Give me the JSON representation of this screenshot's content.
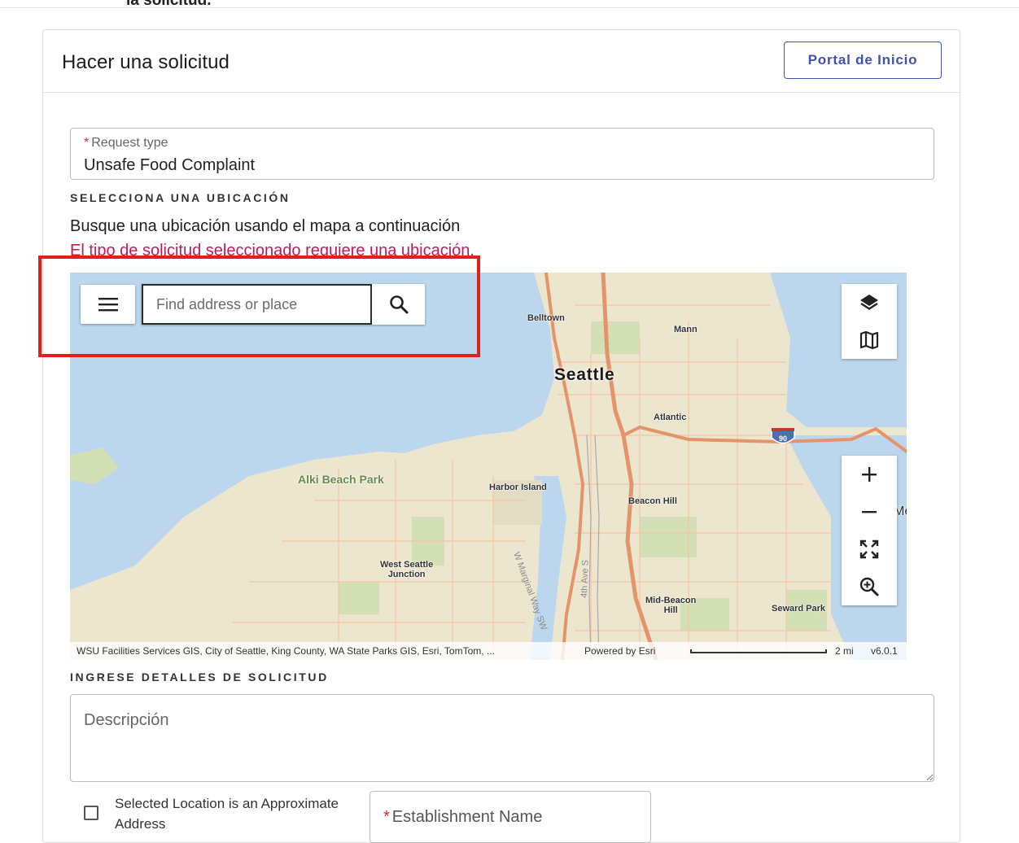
{
  "top_fragment": "la solicitud.",
  "card": {
    "title": "Hacer una solicitud",
    "portal_button": "Portal de Inicio"
  },
  "request_type": {
    "required_mark": "*",
    "label": "Request type",
    "value": "Unsafe Food Complaint"
  },
  "location": {
    "heading": "SELECCIONA UNA UBICACIÓN",
    "hint": "Busque una ubicación usando el mapa a continuación",
    "error": "El tipo de solicitud seleccionado requiere una ubicación."
  },
  "map": {
    "search_placeholder": "Find address or place",
    "labels": {
      "belltown": "Belltown",
      "mann": "Mann",
      "seattle": "Seattle",
      "atlantic": "Atlantic",
      "alki": "Alki Beach Park",
      "harbor": "Harbor Island",
      "beacon_hill": "Beacon Hill",
      "west_seattle_1": "West Seattle",
      "west_seattle_2": "Junction",
      "mid_beacon_1": "Mid-Beacon",
      "mid_beacon_2": "Hill",
      "seward": "Seward Park",
      "w_marginal": "W Marginal Way SW",
      "fourth_ave": "4th Ave S",
      "interstate": "90",
      "edge_fragment": "Me"
    },
    "attribution": "WSU Facilities Services GIS, City of Seattle, King County, WA State Parks GIS, Esri, TomTom, ...",
    "powered_by": "Powered by Esri",
    "scale": "2 mi",
    "version": "v6.0.1"
  },
  "details": {
    "heading": "INGRESE DETALLES DE SOLICITUD",
    "description_placeholder": "Descripción",
    "approx_checkbox_label": "Selected Location is an Approximate Address",
    "establishment_required": "*",
    "establishment_label": "Establishment Name"
  },
  "colors": {
    "accent": "#3f51b5",
    "error": "#c2185b",
    "highlight": "#e02020",
    "water": "#bcd6ee",
    "land": "#ede6cf",
    "park": "#d3dfb4",
    "highway": "#e4936b"
  }
}
